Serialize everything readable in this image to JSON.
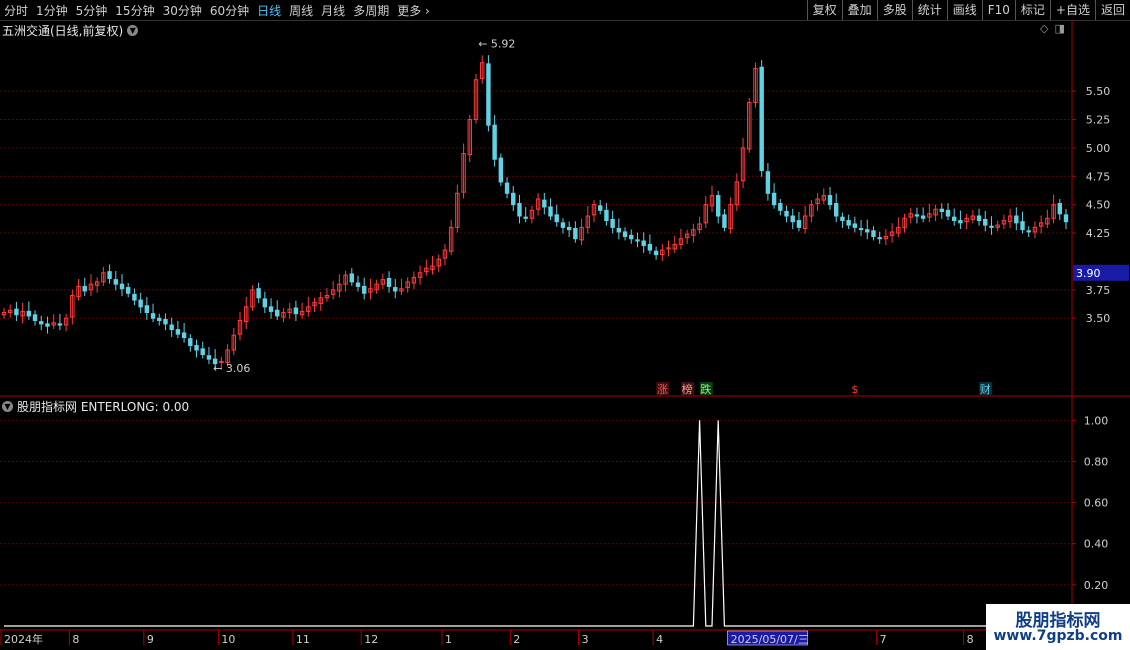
{
  "toolbar": {
    "periods": [
      "分时",
      "1分钟",
      "5分钟",
      "15分钟",
      "30分钟",
      "60分钟",
      "日线",
      "周线",
      "月线",
      "多周期",
      "更多"
    ],
    "active": "日线",
    "right_buttons": [
      "复权",
      "叠加",
      "多股",
      "统计",
      "画线",
      "F10",
      "标记",
      "+自选",
      "返回"
    ]
  },
  "stock": {
    "title": "五洲交通(日线,前复权)"
  },
  "indicator": {
    "title": "股朋指标网  ENTERLONG: 0.00"
  },
  "watermark": {
    "line1": "股朋指标网",
    "line2": "www.7gpzb.com"
  },
  "colors": {
    "up": "#ff3b3b",
    "down": "#5fd3e6",
    "grid": "#7a0000",
    "axis": "#b00000",
    "price_box": "#1a1aa8",
    "date_box": "#1a1aa8",
    "line": "#ffffff"
  },
  "chart_data": [
    {
      "type": "candlestick",
      "ylim": [
        3.0,
        5.95
      ],
      "yticks": [
        "5.50",
        "5.25",
        "5.00",
        "4.75",
        "4.50",
        "4.25",
        "3.75",
        "3.50"
      ],
      "current_price": "3.90",
      "high_label": "5.92",
      "low_label": "3.06",
      "markers": [
        {
          "text": "涨",
          "index": 106,
          "color": "#ff5050",
          "bg": "#3a1010"
        },
        {
          "text": "榜",
          "index": 110,
          "color": "#ff9a9a",
          "bg": "#3a1010"
        },
        {
          "text": "跌",
          "index": 113,
          "color": "#7cff7c",
          "bg": "#103a10"
        },
        {
          "text": "$",
          "index": 137,
          "color": "#ff3b3b",
          "bg": "none"
        },
        {
          "text": "财",
          "index": 158,
          "color": "#5fd3e6",
          "bg": "#0f2a3a"
        }
      ],
      "closes": [
        3.55,
        3.57,
        3.53,
        3.56,
        3.52,
        3.48,
        3.45,
        3.43,
        3.46,
        3.44,
        3.5,
        3.7,
        3.78,
        3.74,
        3.8,
        3.82,
        3.9,
        3.85,
        3.8,
        3.76,
        3.72,
        3.66,
        3.6,
        3.55,
        3.5,
        3.48,
        3.45,
        3.4,
        3.36,
        3.33,
        3.26,
        3.22,
        3.18,
        3.14,
        3.1,
        3.12,
        3.22,
        3.35,
        3.48,
        3.6,
        3.75,
        3.68,
        3.6,
        3.56,
        3.52,
        3.55,
        3.58,
        3.54,
        3.56,
        3.6,
        3.64,
        3.68,
        3.7,
        3.75,
        3.8,
        3.88,
        3.82,
        3.78,
        3.72,
        3.76,
        3.8,
        3.84,
        3.78,
        3.74,
        3.76,
        3.82,
        3.86,
        3.9,
        3.94,
        3.96,
        4.02,
        4.1,
        4.3,
        4.6,
        4.95,
        5.25,
        5.6,
        5.75,
        5.2,
        4.9,
        4.7,
        4.6,
        4.5,
        4.4,
        4.38,
        4.45,
        4.55,
        4.48,
        4.4,
        4.35,
        4.3,
        4.28,
        4.2,
        4.3,
        4.4,
        4.5,
        4.45,
        4.36,
        4.3,
        4.26,
        4.22,
        4.2,
        4.18,
        4.14,
        4.1,
        4.06,
        4.1,
        4.12,
        4.15,
        4.2,
        4.24,
        4.28,
        4.33,
        4.5,
        4.58,
        4.4,
        4.3,
        4.5,
        4.7,
        5.0,
        5.4,
        5.7,
        4.8,
        4.6,
        4.5,
        4.45,
        4.4,
        4.35,
        4.3,
        4.4,
        4.5,
        4.55,
        4.58,
        4.5,
        4.4,
        4.36,
        4.32,
        4.3,
        4.28,
        4.26,
        4.22,
        4.2,
        4.22,
        4.26,
        4.3,
        4.38,
        4.42,
        4.4,
        4.38,
        4.42,
        4.46,
        4.44,
        4.4,
        4.36,
        4.34,
        4.38,
        4.4,
        4.36,
        4.32,
        4.3,
        4.32,
        4.36,
        4.4,
        4.34,
        4.28,
        4.26,
        4.3,
        4.34,
        4.38,
        4.5,
        4.42,
        4.35
      ]
    },
    {
      "type": "line",
      "series_label": "ENTERLONG",
      "ylim": [
        0,
        1.05
      ],
      "yticks": [
        "1.00",
        "0.80",
        "0.60",
        "0.40",
        "0.20"
      ],
      "spikes": [
        112,
        115
      ],
      "x_labels": [
        "2024年",
        "8",
        "9",
        "10",
        "11",
        "12",
        "1",
        "2",
        "3",
        "4",
        "2025/05/07/三",
        "7",
        "8"
      ],
      "x_label_index": [
        0,
        11,
        23,
        35,
        47,
        58,
        71,
        82,
        93,
        105,
        117,
        141,
        155
      ]
    }
  ]
}
